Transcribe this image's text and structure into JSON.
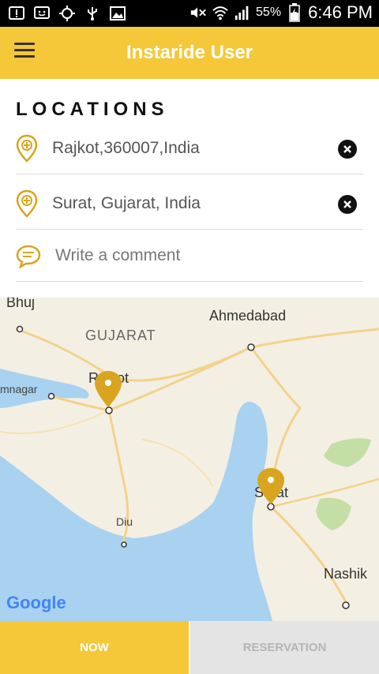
{
  "status_bar": {
    "battery": "55%",
    "time": "6:46 PM",
    "icons": [
      "alert-icon",
      "message-icon",
      "gps-icon",
      "usb-icon",
      "gallery-icon",
      "mute-icon",
      "wifi-icon",
      "signal-icon",
      "battery-icon"
    ]
  },
  "app_bar": {
    "title": "Instaride User",
    "menu_icon": "hamburger-menu-icon",
    "color": "#f5c83a"
  },
  "locations": {
    "heading": "LOCATIONS",
    "pickup": {
      "value": "Rajkot,360007,India",
      "icon": "location-pin-icon"
    },
    "dropoff": {
      "value": "Surat, Gujarat, India",
      "icon": "location-pin-icon"
    },
    "comment": {
      "placeholder": "Write a comment",
      "icon": "comment-bubble-icon"
    }
  },
  "map": {
    "labels": {
      "bhuj": "Bhuj",
      "gujarat": "GUJARAT",
      "ahmedabad": "Ahmedabad",
      "jamnagar": "mnagar",
      "rajkot": "Rajkot",
      "surat": "Surat",
      "diu": "Diu",
      "nashik": "Nashik"
    },
    "attribution": "Google",
    "pin_color": "#d9a520"
  },
  "tabs": {
    "now": "NOW",
    "reservation": "RESERVATION"
  }
}
